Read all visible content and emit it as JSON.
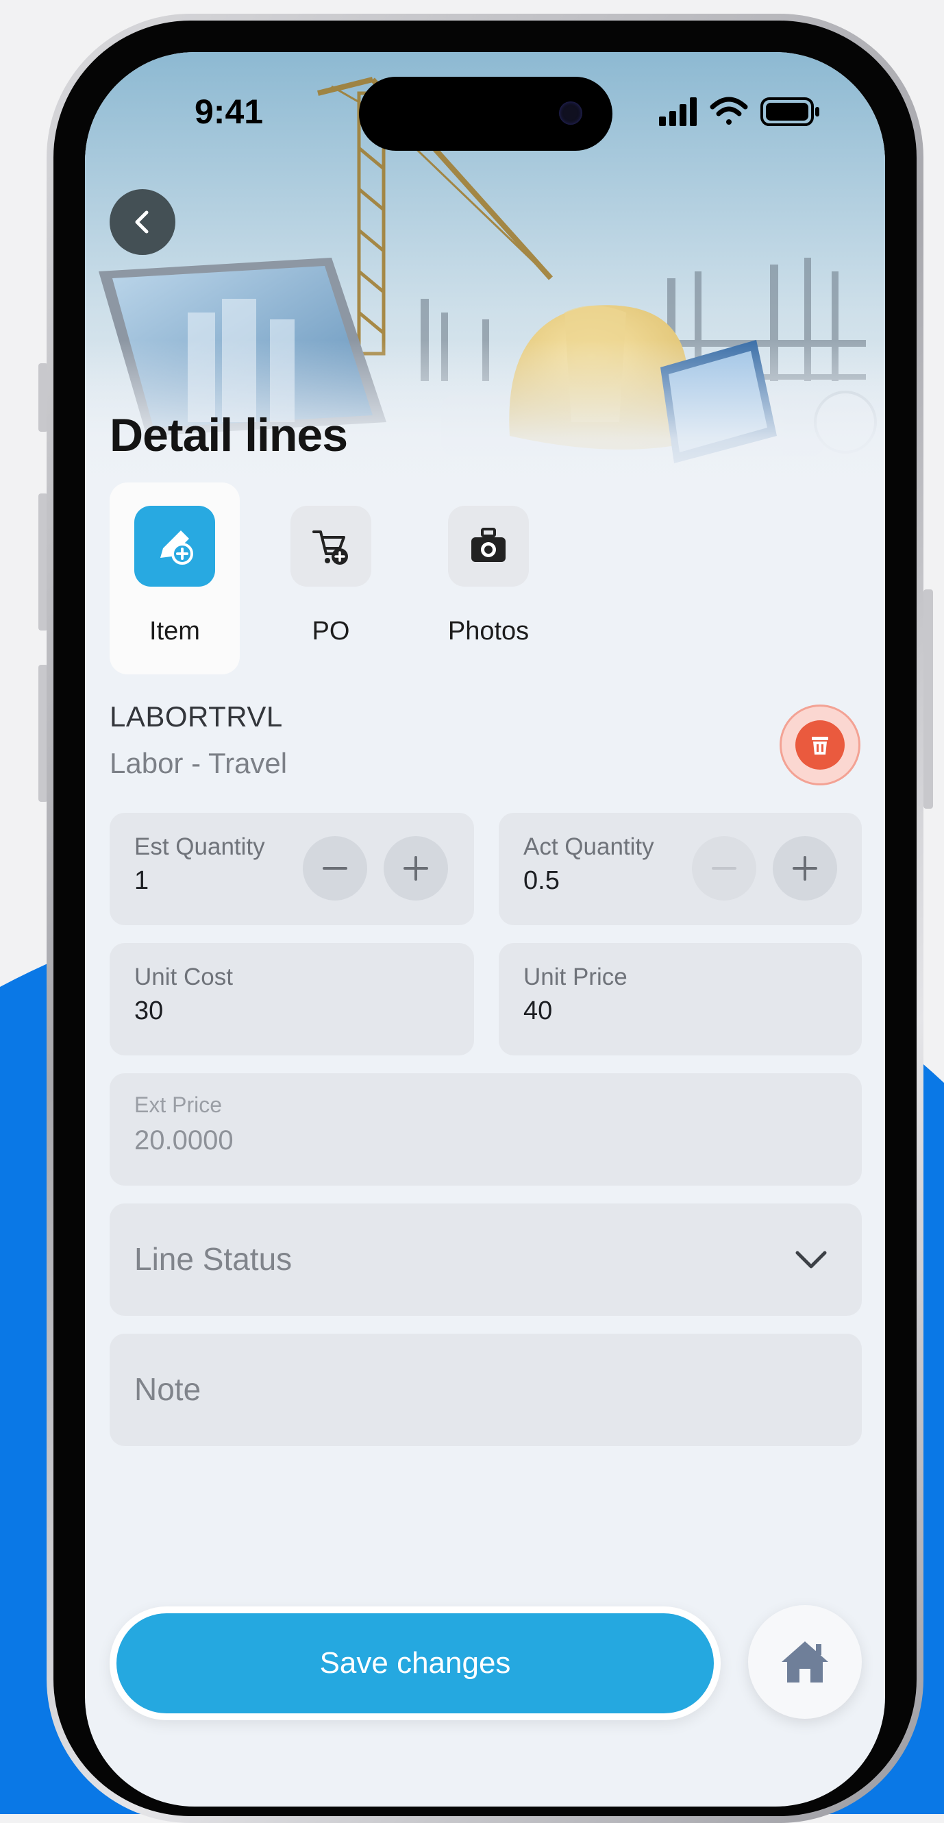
{
  "status_bar": {
    "time": "9:41"
  },
  "page": {
    "title": "Detail lines"
  },
  "tabs": [
    {
      "label": "Item",
      "active": true
    },
    {
      "label": "PO",
      "active": false
    },
    {
      "label": "Photos",
      "active": false
    }
  ],
  "item": {
    "code": "LABORTRVL",
    "description": "Labor - Travel"
  },
  "fields": {
    "est_quantity": {
      "label": "Est Quantity",
      "value": "1"
    },
    "act_quantity": {
      "label": "Act Quantity",
      "value": "0.5"
    },
    "unit_cost": {
      "label": "Unit Cost",
      "value": "30"
    },
    "unit_price": {
      "label": "Unit Price",
      "value": "40"
    },
    "ext_price": {
      "label": "Ext Price",
      "value": "20.0000"
    },
    "line_status": {
      "placeholder": "Line Status"
    },
    "note": {
      "placeholder": "Note"
    }
  },
  "actions": {
    "save_label": "Save changes"
  },
  "colors": {
    "accent": "#25a8e0",
    "danger": "#ea5a3e",
    "backdrop_blue": "#0a78e6"
  }
}
